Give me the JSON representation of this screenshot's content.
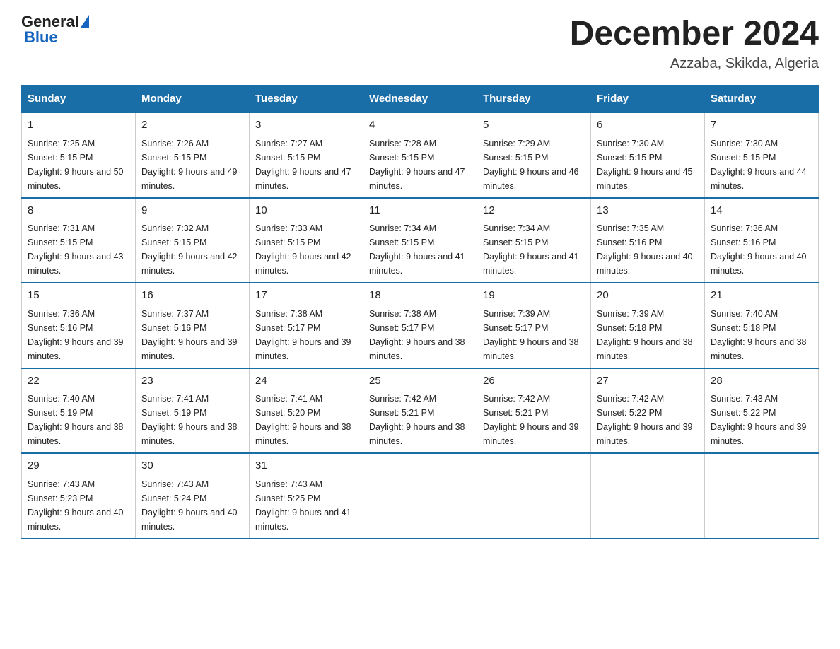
{
  "logo": {
    "general": "General",
    "blue": "Blue"
  },
  "header": {
    "title": "December 2024",
    "subtitle": "Azzaba, Skikda, Algeria"
  },
  "weekdays": [
    "Sunday",
    "Monday",
    "Tuesday",
    "Wednesday",
    "Thursday",
    "Friday",
    "Saturday"
  ],
  "weeks": [
    [
      {
        "day": "1",
        "sunrise": "7:25 AM",
        "sunset": "5:15 PM",
        "daylight": "9 hours and 50 minutes."
      },
      {
        "day": "2",
        "sunrise": "7:26 AM",
        "sunset": "5:15 PM",
        "daylight": "9 hours and 49 minutes."
      },
      {
        "day": "3",
        "sunrise": "7:27 AM",
        "sunset": "5:15 PM",
        "daylight": "9 hours and 47 minutes."
      },
      {
        "day": "4",
        "sunrise": "7:28 AM",
        "sunset": "5:15 PM",
        "daylight": "9 hours and 47 minutes."
      },
      {
        "day": "5",
        "sunrise": "7:29 AM",
        "sunset": "5:15 PM",
        "daylight": "9 hours and 46 minutes."
      },
      {
        "day": "6",
        "sunrise": "7:30 AM",
        "sunset": "5:15 PM",
        "daylight": "9 hours and 45 minutes."
      },
      {
        "day": "7",
        "sunrise": "7:30 AM",
        "sunset": "5:15 PM",
        "daylight": "9 hours and 44 minutes."
      }
    ],
    [
      {
        "day": "8",
        "sunrise": "7:31 AM",
        "sunset": "5:15 PM",
        "daylight": "9 hours and 43 minutes."
      },
      {
        "day": "9",
        "sunrise": "7:32 AM",
        "sunset": "5:15 PM",
        "daylight": "9 hours and 42 minutes."
      },
      {
        "day": "10",
        "sunrise": "7:33 AM",
        "sunset": "5:15 PM",
        "daylight": "9 hours and 42 minutes."
      },
      {
        "day": "11",
        "sunrise": "7:34 AM",
        "sunset": "5:15 PM",
        "daylight": "9 hours and 41 minutes."
      },
      {
        "day": "12",
        "sunrise": "7:34 AM",
        "sunset": "5:15 PM",
        "daylight": "9 hours and 41 minutes."
      },
      {
        "day": "13",
        "sunrise": "7:35 AM",
        "sunset": "5:16 PM",
        "daylight": "9 hours and 40 minutes."
      },
      {
        "day": "14",
        "sunrise": "7:36 AM",
        "sunset": "5:16 PM",
        "daylight": "9 hours and 40 minutes."
      }
    ],
    [
      {
        "day": "15",
        "sunrise": "7:36 AM",
        "sunset": "5:16 PM",
        "daylight": "9 hours and 39 minutes."
      },
      {
        "day": "16",
        "sunrise": "7:37 AM",
        "sunset": "5:16 PM",
        "daylight": "9 hours and 39 minutes."
      },
      {
        "day": "17",
        "sunrise": "7:38 AM",
        "sunset": "5:17 PM",
        "daylight": "9 hours and 39 minutes."
      },
      {
        "day": "18",
        "sunrise": "7:38 AM",
        "sunset": "5:17 PM",
        "daylight": "9 hours and 38 minutes."
      },
      {
        "day": "19",
        "sunrise": "7:39 AM",
        "sunset": "5:17 PM",
        "daylight": "9 hours and 38 minutes."
      },
      {
        "day": "20",
        "sunrise": "7:39 AM",
        "sunset": "5:18 PM",
        "daylight": "9 hours and 38 minutes."
      },
      {
        "day": "21",
        "sunrise": "7:40 AM",
        "sunset": "5:18 PM",
        "daylight": "9 hours and 38 minutes."
      }
    ],
    [
      {
        "day": "22",
        "sunrise": "7:40 AM",
        "sunset": "5:19 PM",
        "daylight": "9 hours and 38 minutes."
      },
      {
        "day": "23",
        "sunrise": "7:41 AM",
        "sunset": "5:19 PM",
        "daylight": "9 hours and 38 minutes."
      },
      {
        "day": "24",
        "sunrise": "7:41 AM",
        "sunset": "5:20 PM",
        "daylight": "9 hours and 38 minutes."
      },
      {
        "day": "25",
        "sunrise": "7:42 AM",
        "sunset": "5:21 PM",
        "daylight": "9 hours and 38 minutes."
      },
      {
        "day": "26",
        "sunrise": "7:42 AM",
        "sunset": "5:21 PM",
        "daylight": "9 hours and 39 minutes."
      },
      {
        "day": "27",
        "sunrise": "7:42 AM",
        "sunset": "5:22 PM",
        "daylight": "9 hours and 39 minutes."
      },
      {
        "day": "28",
        "sunrise": "7:43 AM",
        "sunset": "5:22 PM",
        "daylight": "9 hours and 39 minutes."
      }
    ],
    [
      {
        "day": "29",
        "sunrise": "7:43 AM",
        "sunset": "5:23 PM",
        "daylight": "9 hours and 40 minutes."
      },
      {
        "day": "30",
        "sunrise": "7:43 AM",
        "sunset": "5:24 PM",
        "daylight": "9 hours and 40 minutes."
      },
      {
        "day": "31",
        "sunrise": "7:43 AM",
        "sunset": "5:25 PM",
        "daylight": "9 hours and 41 minutes."
      },
      null,
      null,
      null,
      null
    ]
  ]
}
